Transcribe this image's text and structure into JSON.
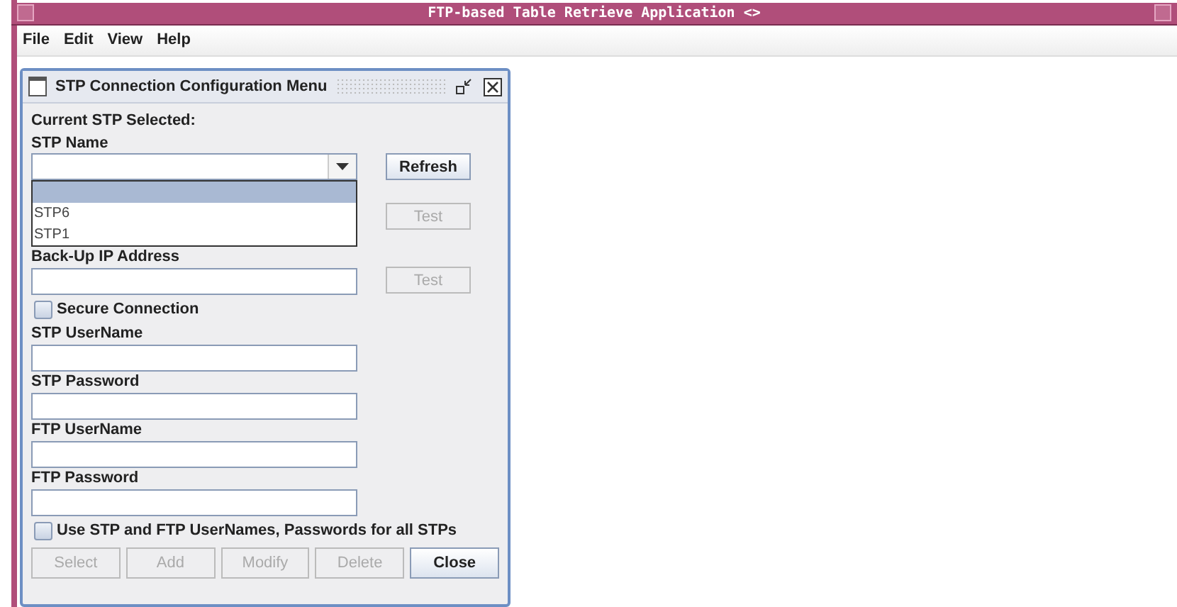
{
  "window": {
    "title": "FTP-based Table Retrieve Application <>"
  },
  "menu": [
    "File",
    "Edit",
    "View",
    "Help"
  ],
  "dialog": {
    "title": "STP Connection Configuration Menu",
    "current_label": "Current STP Selected:",
    "stp_name": {
      "label": "STP Name",
      "button": {
        "label": "Refresh",
        "disabled": false
      },
      "options": [
        {
          "selected": true
        },
        {
          "label": "STP6",
          "selected": false
        },
        {
          "label": "STP1",
          "selected": false
        }
      ]
    },
    "primary_test": {
      "label": "Test",
      "disabled": true
    },
    "rows": [
      {
        "kind": "field",
        "label": "Back-Up IP Address",
        "button": {
          "label": "Test",
          "disabled": true
        }
      },
      {
        "kind": "checkbox",
        "label": "Secure Connection",
        "checked": false
      },
      {
        "kind": "field",
        "label": "STP UserName"
      },
      {
        "kind": "field",
        "label": "STP Password"
      },
      {
        "kind": "field",
        "label": "FTP UserName"
      },
      {
        "kind": "field",
        "label": "FTP Password"
      },
      {
        "kind": "checkbox",
        "label": "Use STP and FTP UserNames, Passwords for all STPs",
        "checked": false
      }
    ],
    "buttons": [
      {
        "label": "Select",
        "disabled": true
      },
      {
        "label": "Add",
        "disabled": true
      },
      {
        "label": "Modify",
        "disabled": true
      },
      {
        "label": "Delete",
        "disabled": true
      },
      {
        "label": "Close",
        "disabled": false
      }
    ]
  }
}
